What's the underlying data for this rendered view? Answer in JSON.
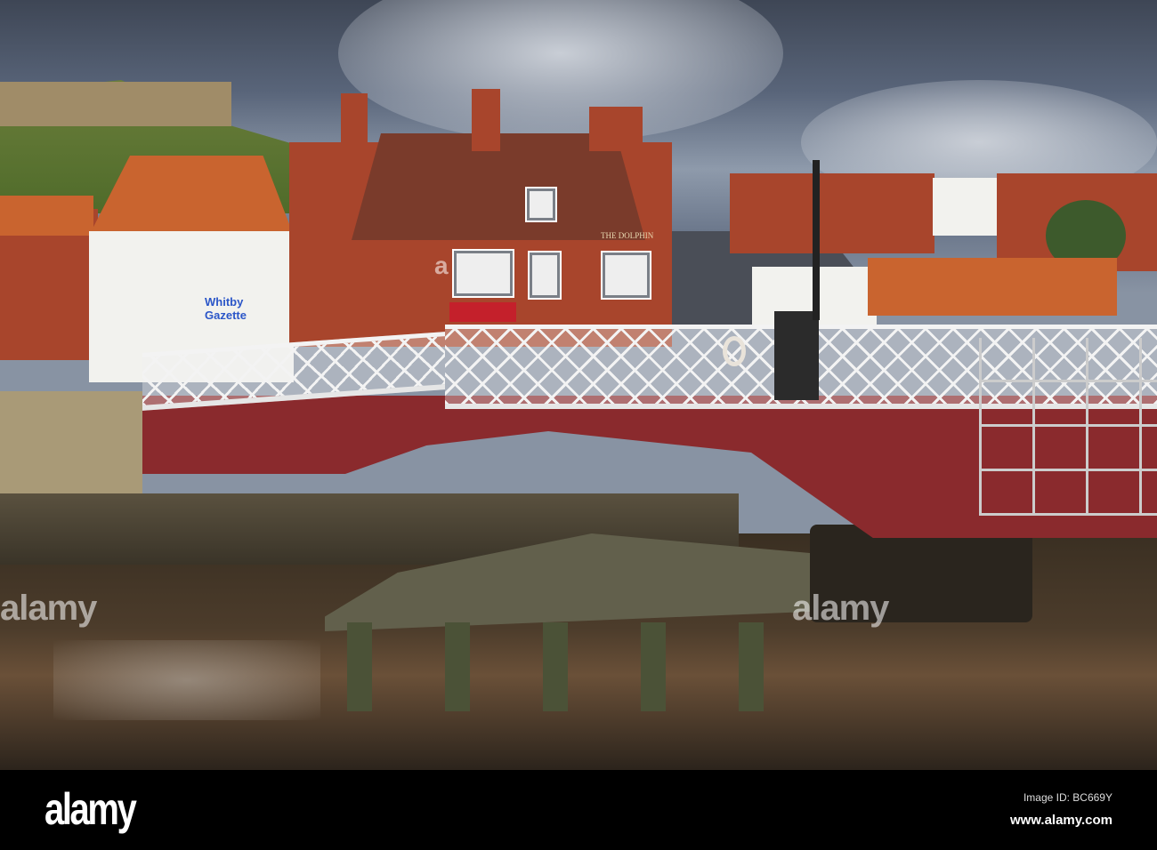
{
  "photo": {
    "description_signs": {
      "gazette": [
        "Whitby",
        "Gazette"
      ],
      "pub_name": "THE DOLPHIN"
    },
    "watermarks": [
      "alamy",
      "alamy",
      "a"
    ]
  },
  "footer": {
    "logo": "alamy",
    "image_id": "Image ID: BC669Y",
    "url": "www.alamy.com"
  }
}
